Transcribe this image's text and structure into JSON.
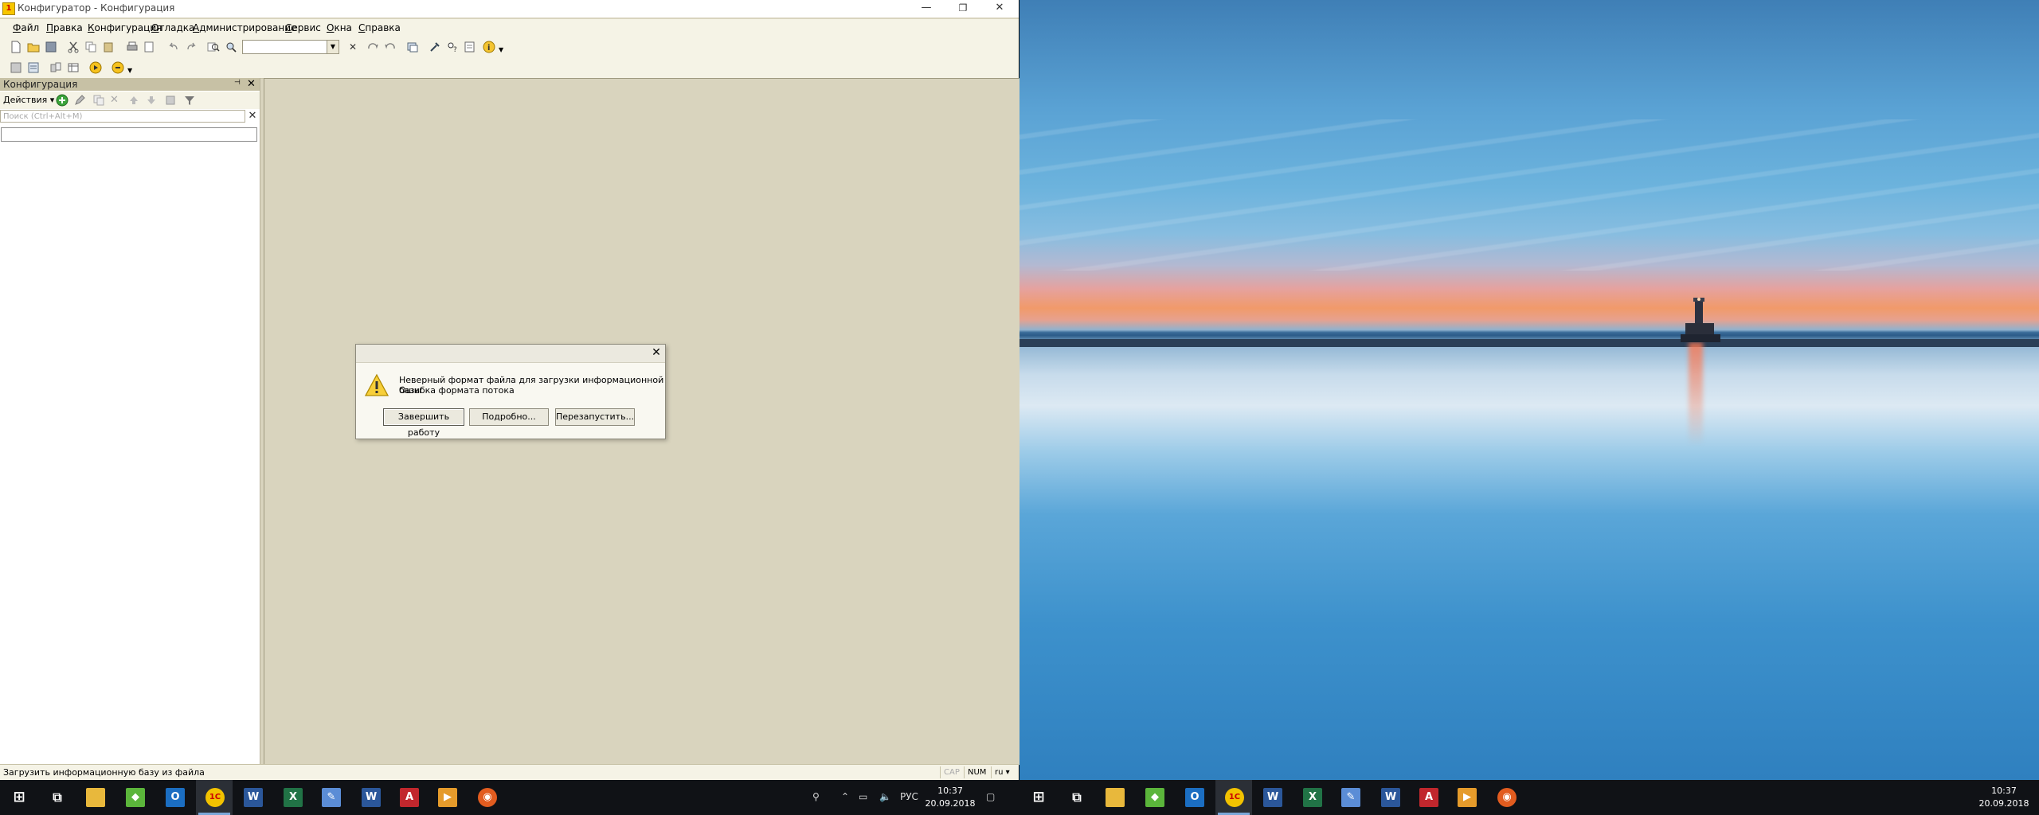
{
  "window": {
    "title": "Конфигуратор - Конфигурация",
    "controls": {
      "minimize": "—",
      "restore": "❐",
      "close": "✕"
    }
  },
  "menu": [
    "Файл",
    "Правка",
    "Конфигурация",
    "Отладка",
    "Администрирование",
    "Сервис",
    "Окна",
    "Справка"
  ],
  "toolbar": {
    "combo_value": ""
  },
  "panel": {
    "title": "Конфигурация",
    "actions_label": "Действия ▾",
    "search_placeholder": "Поиск (Ctrl+Alt+M)",
    "pin": "📌",
    "close": "✕"
  },
  "dialog": {
    "message_line1": "Неверный формат файла для загрузки информационной базы",
    "message_line2": "Ошибка формата потока",
    "close": "✕",
    "buttons": {
      "finish": "Завершить работу",
      "details": "Подробно...",
      "restart": "Перезапустить..."
    }
  },
  "statusbar": {
    "text": "Загрузить информационную базу из файла",
    "indicators": [
      "CAP",
      "NUM",
      "ru ▾"
    ]
  },
  "taskbar_left": {
    "tray_lang": "РУС",
    "time": "10:37",
    "date": "20.09.2018",
    "apps": [
      {
        "name": "start",
        "glyph": "⊞",
        "color": "#101216"
      },
      {
        "name": "task-view",
        "glyph": "⧉",
        "color": "#101216"
      },
      {
        "name": "explorer",
        "glyph": "▬",
        "color": "#e8b83c"
      },
      {
        "name": "app-green",
        "glyph": "◆",
        "color": "#5bb53b"
      },
      {
        "name": "outlook",
        "glyph": "O",
        "color": "#1b6ec2"
      },
      {
        "name": "1c",
        "glyph": "1С",
        "color": "#f2c200"
      },
      {
        "name": "word",
        "glyph": "W",
        "color": "#2b579a"
      },
      {
        "name": "excel",
        "glyph": "X",
        "color": "#217346"
      },
      {
        "name": "paint",
        "glyph": "✎",
        "color": "#5b8dd6"
      },
      {
        "name": "word-doc",
        "glyph": "W",
        "color": "#2b579a"
      },
      {
        "name": "acrobat",
        "glyph": "A",
        "color": "#c1272d"
      },
      {
        "name": "media",
        "glyph": "▶",
        "color": "#e59b2b"
      },
      {
        "name": "firefox",
        "glyph": "◉",
        "color": "#e25c1f"
      }
    ]
  },
  "taskbar_right": {
    "time": "10:37",
    "date": "20.09.2018"
  },
  "colors": {
    "app_bg": "#d9d4be",
    "toolbar_bg": "#f5f3e6",
    "panel_header": "#c7c1a5",
    "taskbar": "#101216"
  }
}
